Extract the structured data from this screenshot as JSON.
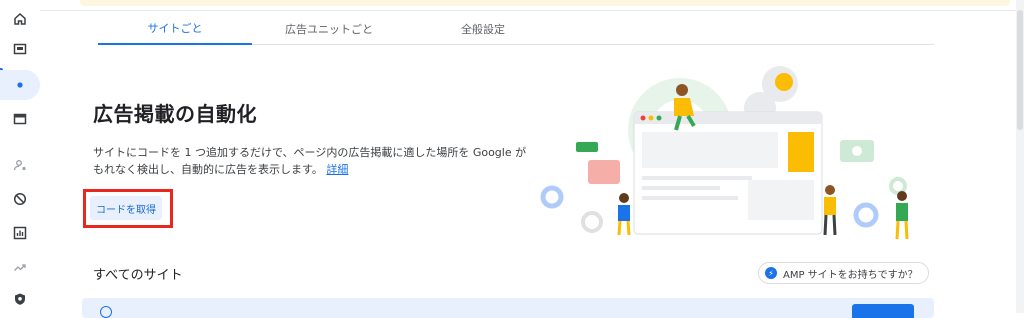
{
  "nav": {
    "items": [
      {
        "name": "home-icon"
      },
      {
        "name": "overview-icon"
      },
      {
        "name": "sites-icon",
        "active": true
      },
      {
        "name": "ad-units-icon"
      },
      {
        "name": "privacy-icon"
      },
      {
        "name": "blocking-icon"
      },
      {
        "name": "reports-icon"
      },
      {
        "name": "optimization-icon"
      },
      {
        "name": "policy-icon"
      }
    ]
  },
  "tabs": [
    {
      "label": "サイトごと",
      "active": true
    },
    {
      "label": "広告ユニットごと",
      "active": false
    },
    {
      "label": "全般設定",
      "active": false
    }
  ],
  "hero": {
    "title": "広告掲載の自動化",
    "description": "サイトにコードを 1 つ追加するだけで、ページ内の広告掲載に適した場所を Google がもれなく検出し、自動的に広告を表示します。",
    "learn_more": "詳細",
    "get_code_label": "コードを取得"
  },
  "sites": {
    "section_title": "すべてのサイト",
    "amp_chip_label": "AMP サイトをお持ちですか？"
  },
  "colors": {
    "accent": "#1a73e8",
    "highlight": "#e8281e",
    "banner": "#fef7e0"
  }
}
